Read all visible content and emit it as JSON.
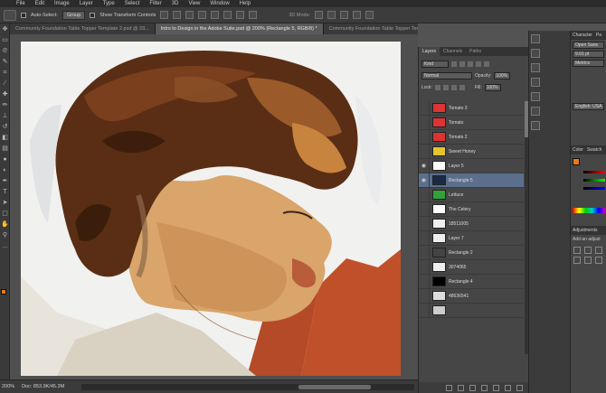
{
  "menu": [
    "File",
    "Edit",
    "Image",
    "Layer",
    "Type",
    "Select",
    "Filter",
    "3D",
    "View",
    "Window",
    "Help"
  ],
  "options": {
    "auto_select_label": "Auto-Select:",
    "auto_select_value": "Group",
    "show_transform_label": "Show Transform Controls",
    "mode3d_label": "3D Mode:"
  },
  "doc_tabs": [
    {
      "label": "Community Foundation Table Topper Template 2.psd @ 33...",
      "active": false
    },
    {
      "label": "Intro to Design in the Adobe Suite.psd @ 200% (Rectangle 5, RGB/8) *",
      "active": true
    },
    {
      "label": "Community Foundation Table Topper Template 2.psd @ 25...",
      "active": false
    }
  ],
  "status": {
    "zoom": "200%",
    "doc": "Doc: 853.9K/45.3M"
  },
  "layers_panel": {
    "tabs": [
      "Layers",
      "Channels",
      "Paths"
    ],
    "kind_label": "Kind",
    "blend_mode": "Normal",
    "opacity_label": "Opacity:",
    "opacity_value": "100%",
    "lock_label": "Lock:",
    "fill_label": "Fill:",
    "fill_value": "100%",
    "layers": [
      {
        "name": "Tomato 3",
        "visible": false,
        "selected": false,
        "thumb": "#d33"
      },
      {
        "name": "Tomato",
        "visible": false,
        "selected": false,
        "thumb": "#d33"
      },
      {
        "name": "Tomato 2",
        "visible": false,
        "selected": false,
        "thumb": "#d33"
      },
      {
        "name": "Sweet Honey",
        "visible": false,
        "selected": false,
        "thumb": "#e6c42a"
      },
      {
        "name": "Layer 5",
        "visible": true,
        "selected": false,
        "thumb": "#fff"
      },
      {
        "name": "Rectangle 5",
        "visible": true,
        "selected": true,
        "thumb": "#1b2a44"
      },
      {
        "name": "Lettuce",
        "visible": false,
        "selected": false,
        "thumb": "#2fa33a"
      },
      {
        "name": "The Celery",
        "visible": false,
        "selected": false,
        "thumb": "#fff"
      },
      {
        "name": "18511005",
        "visible": false,
        "selected": false,
        "thumb": "#eee"
      },
      {
        "name": "Layer 7",
        "visible": false,
        "selected": false,
        "thumb": "#eee"
      },
      {
        "name": "Rectangle 2",
        "visible": false,
        "selected": false,
        "thumb": "#444"
      },
      {
        "name": "3074065",
        "visible": false,
        "selected": false,
        "thumb": "#eee"
      },
      {
        "name": "Rectangle 4",
        "visible": false,
        "selected": false,
        "thumb": "#000"
      },
      {
        "name": "48636541",
        "visible": false,
        "selected": false,
        "thumb": "#ddd"
      },
      {
        "name": "",
        "visible": false,
        "selected": false,
        "thumb": "#ccc"
      }
    ]
  },
  "character_panel": {
    "tabs": [
      "Character",
      "Pa"
    ],
    "font": "Open Sans",
    "size": "9.01 pt",
    "kerning": "Metrics",
    "language": "English: USA"
  },
  "color_panel": {
    "tabs": [
      "Color",
      "Swatch"
    ],
    "foreground": "#e87b1c",
    "channels": [
      "R",
      "G",
      "B"
    ]
  },
  "adjustments_panel": {
    "title": "Adjustments",
    "hint": "Add an adjust"
  },
  "colors": {
    "accent_orange": "#e87b1c",
    "selected_layer": "#5b6f8c",
    "backdrop_red": "#c0502a"
  }
}
